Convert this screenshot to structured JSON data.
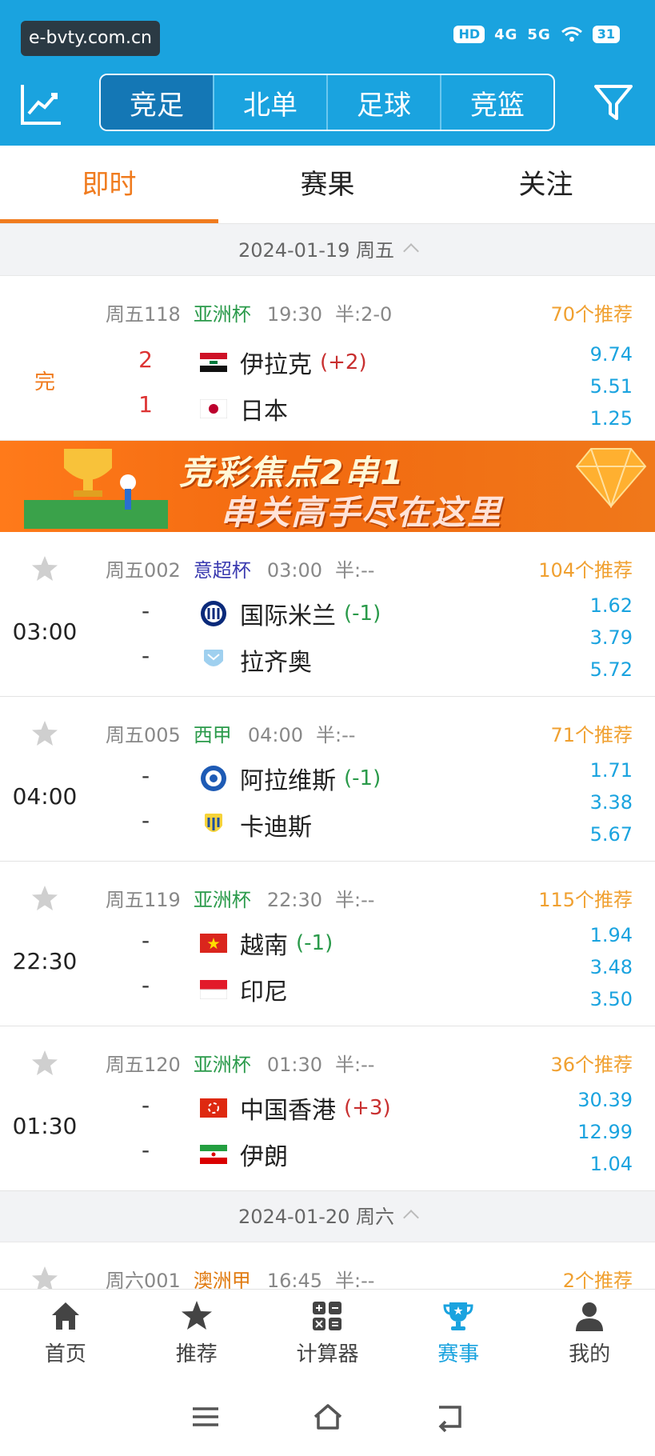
{
  "watermark": "e-bvty.com.cn",
  "status_bar": {
    "network": "HD",
    "signal1": "4G",
    "signal2": "5G",
    "battery": "31"
  },
  "header": {
    "segments": [
      "竞足",
      "北单",
      "足球",
      "竞篮"
    ],
    "active_segment": "竞足"
  },
  "tabs": [
    "即时",
    "赛果",
    "关注"
  ],
  "active_tab": "即时",
  "banner": {
    "line1": "竞彩焦点2串1",
    "line2": "串关高手尽在这里"
  },
  "dates": [
    "2024-01-19 周五",
    "2024-01-20 周六"
  ],
  "matches": [
    {
      "code": "周五118",
      "league": "亚洲杯",
      "league_color": "#2a9a4a",
      "time": "19:30",
      "half": "半:2-0",
      "recommend": "70个推荐",
      "status": "完",
      "home_score": "2",
      "away_score": "1",
      "home": "伊拉克",
      "home_hcp": "(+2)",
      "away": "日本",
      "odds": [
        "9.74",
        "5.51",
        "1.25"
      ]
    },
    {
      "code": "周五002",
      "league": "意超杯",
      "league_color": "#3a3ab0",
      "time": "03:00",
      "half": "半:--",
      "recommend": "104个推荐",
      "left_time": "03:00",
      "home_score": "-",
      "away_score": "-",
      "home": "国际米兰",
      "home_hcp": "(-1)",
      "away": "拉齐奥",
      "odds": [
        "1.62",
        "3.79",
        "5.72"
      ]
    },
    {
      "code": "周五005",
      "league": "西甲",
      "league_color": "#2a9a4a",
      "time": "04:00",
      "half": "半:--",
      "recommend": "71个推荐",
      "left_time": "04:00",
      "home_score": "-",
      "away_score": "-",
      "home": "阿拉维斯",
      "home_hcp": "(-1)",
      "away": "卡迪斯",
      "odds": [
        "1.71",
        "3.38",
        "5.67"
      ]
    },
    {
      "code": "周五119",
      "league": "亚洲杯",
      "league_color": "#2a9a4a",
      "time": "22:30",
      "half": "半:--",
      "recommend": "115个推荐",
      "left_time": "22:30",
      "home_score": "-",
      "away_score": "-",
      "home": "越南",
      "home_hcp": "(-1)",
      "away": "印尼",
      "odds": [
        "1.94",
        "3.48",
        "3.50"
      ]
    },
    {
      "code": "周五120",
      "league": "亚洲杯",
      "league_color": "#2a9a4a",
      "time": "01:30",
      "half": "半:--",
      "recommend": "36个推荐",
      "left_time": "01:30",
      "home_score": "-",
      "away_score": "-",
      "home": "中国香港",
      "home_hcp": "(+3)",
      "away": "伊朗",
      "odds": [
        "30.39",
        "12.99",
        "1.04"
      ]
    },
    {
      "code": "周六001",
      "league": "澳洲甲",
      "league_color": "#e07a10",
      "time": "16:45",
      "half": "半:--",
      "recommend": "2个推荐"
    }
  ],
  "bottom_nav": [
    "首页",
    "推荐",
    "计算器",
    "赛事",
    "我的"
  ],
  "active_nav": "赛事"
}
